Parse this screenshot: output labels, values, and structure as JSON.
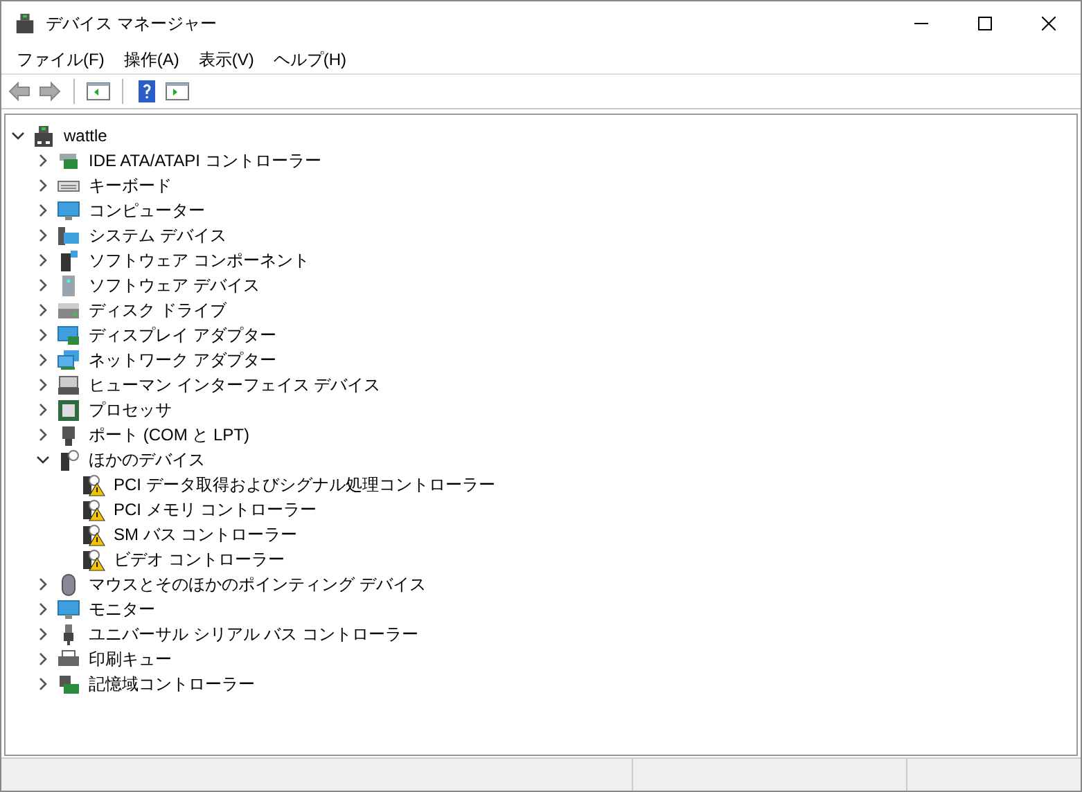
{
  "window": {
    "title": "デバイス マネージャー"
  },
  "menu": [
    "ファイル(F)",
    "操作(A)",
    "表示(V)",
    "ヘルプ(H)"
  ],
  "tree": {
    "label": "wattle",
    "expanded": true,
    "children": [
      {
        "label": "IDE ATA/ATAPI コントローラー",
        "expanded": false
      },
      {
        "label": "キーボード",
        "expanded": false
      },
      {
        "label": "コンピューター",
        "expanded": false
      },
      {
        "label": "システム デバイス",
        "expanded": false
      },
      {
        "label": "ソフトウェア コンポーネント",
        "expanded": false
      },
      {
        "label": "ソフトウェア デバイス",
        "expanded": false
      },
      {
        "label": "ディスク ドライブ",
        "expanded": false
      },
      {
        "label": "ディスプレイ アダプター",
        "expanded": false
      },
      {
        "label": "ネットワーク アダプター",
        "expanded": false
      },
      {
        "label": "ヒューマン インターフェイス デバイス",
        "expanded": false
      },
      {
        "label": "プロセッサ",
        "expanded": false
      },
      {
        "label": "ポート (COM と LPT)",
        "expanded": false
      },
      {
        "label": "ほかのデバイス",
        "expanded": true,
        "children": [
          {
            "label": "PCI データ取得およびシグナル処理コントローラー",
            "warning": true
          },
          {
            "label": "PCI メモリ コントローラー",
            "warning": true
          },
          {
            "label": "SM バス コントローラー",
            "warning": true
          },
          {
            "label": "ビデオ コントローラー",
            "warning": true
          }
        ]
      },
      {
        "label": "マウスとそのほかのポインティング デバイス",
        "expanded": false
      },
      {
        "label": "モニター",
        "expanded": false
      },
      {
        "label": "ユニバーサル シリアル バス コントローラー",
        "expanded": false
      },
      {
        "label": "印刷キュー",
        "expanded": false
      },
      {
        "label": "記憶域コントローラー",
        "expanded": false
      }
    ]
  }
}
